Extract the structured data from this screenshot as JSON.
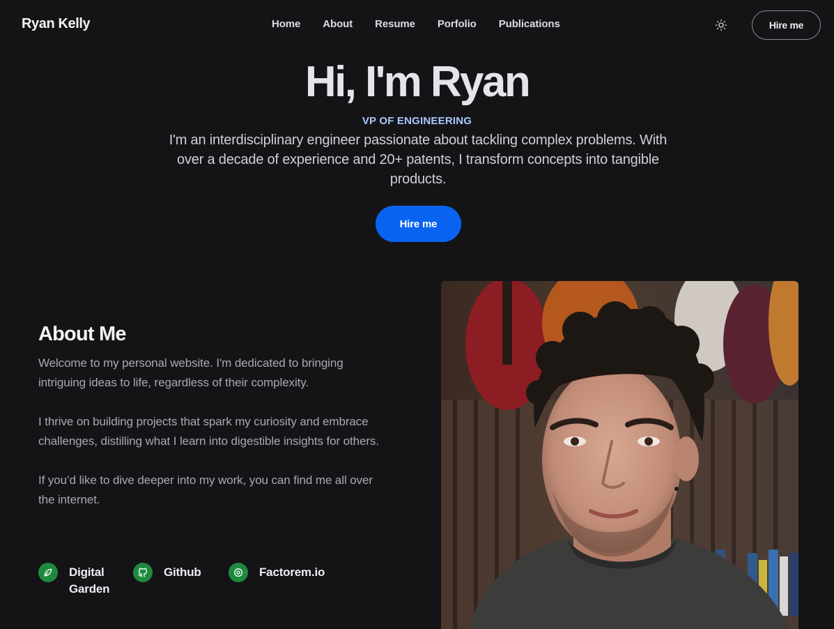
{
  "header": {
    "brand": "Ryan Kelly",
    "nav": [
      {
        "label": "Home"
      },
      {
        "label": "About"
      },
      {
        "label": "Resume"
      },
      {
        "label": "Porfolio"
      },
      {
        "label": "Publications"
      }
    ],
    "theme_icon": "sun-icon",
    "hire_label": "Hire me"
  },
  "hero": {
    "title": "Hi, I'm Ryan",
    "role": "VP OF ENGINEERING",
    "lead": "I'm an interdisciplinary engineer passionate about tackling complex problems. With over a decade of experience and 20+ patents, I transform concepts into tangible products.",
    "cta_label": "Hire me"
  },
  "about": {
    "heading": "About Me",
    "paragraphs": [
      "Welcome to my personal website. I'm dedicated to bringing intriguing ideas to life, regardless of their complexity.",
      "I thrive on building projects that spark my curiosity and embrace challenges, distilling what I learn into digestible insights for others.",
      "If you’d like to dive deeper into my work, you can find me all over the internet."
    ],
    "links": [
      {
        "label": "Digital Garden",
        "icon": "leaf-icon"
      },
      {
        "label": "Github",
        "icon": "github-icon"
      },
      {
        "label": "Factorem.io",
        "icon": "factorem-icon"
      }
    ]
  },
  "colors": {
    "background": "#141417",
    "accent": "#0a63f0",
    "role": "#a9c8ff",
    "link_icon_bg": "#1f8a3d"
  }
}
